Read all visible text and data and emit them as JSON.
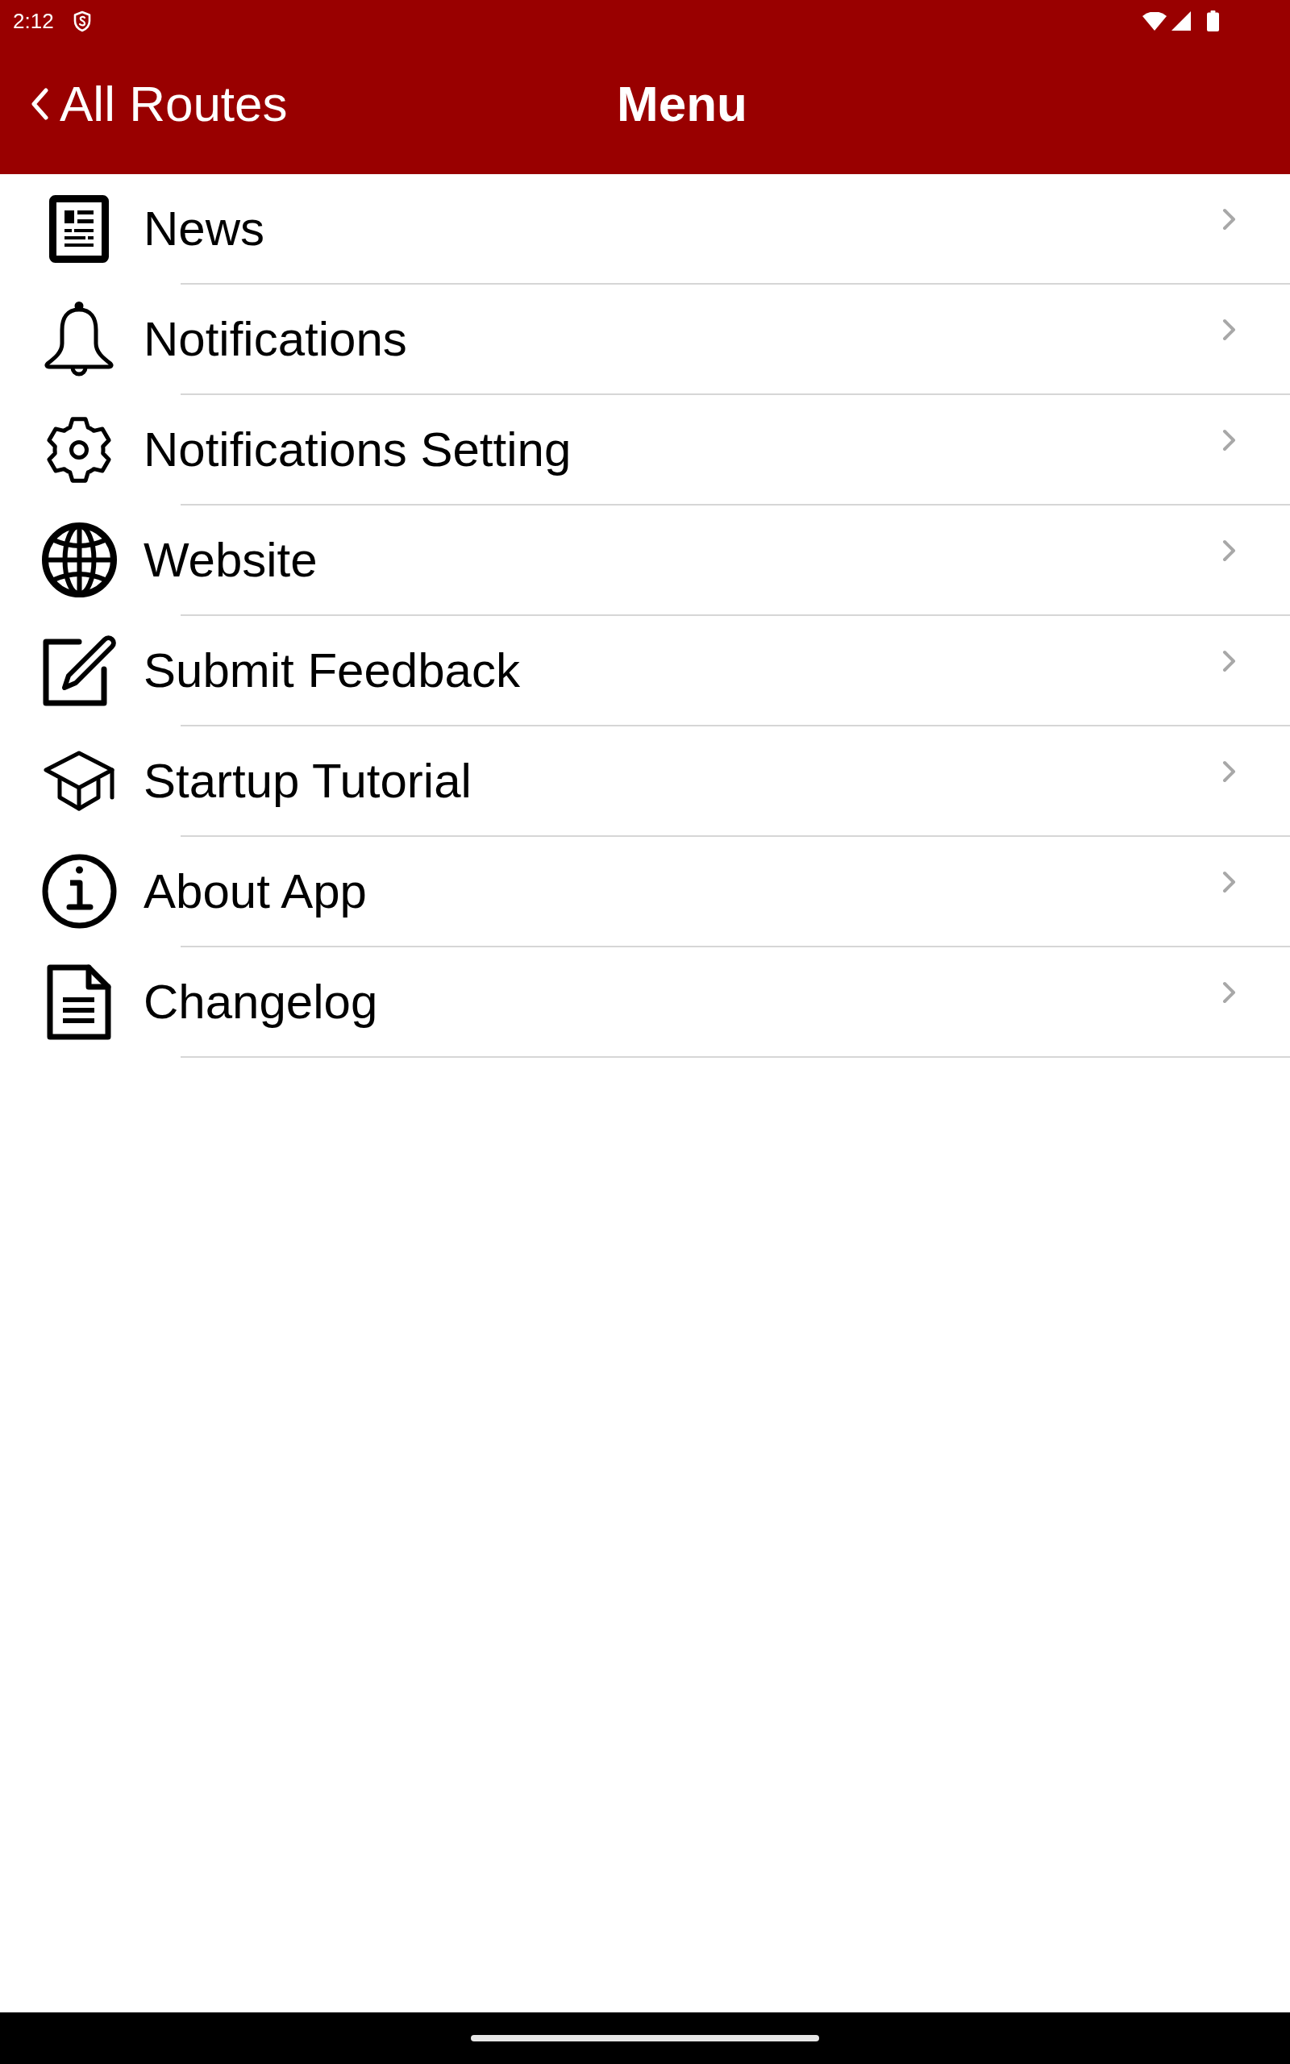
{
  "status_bar": {
    "time": "2:12"
  },
  "header": {
    "back_label": "All Routes",
    "title": "Menu"
  },
  "menu_items": [
    {
      "label": "News"
    },
    {
      "label": "Notifications"
    },
    {
      "label": "Notifications Setting"
    },
    {
      "label": "Website"
    },
    {
      "label": "Submit Feedback"
    },
    {
      "label": "Startup Tutorial"
    },
    {
      "label": "About App"
    },
    {
      "label": "Changelog"
    }
  ]
}
